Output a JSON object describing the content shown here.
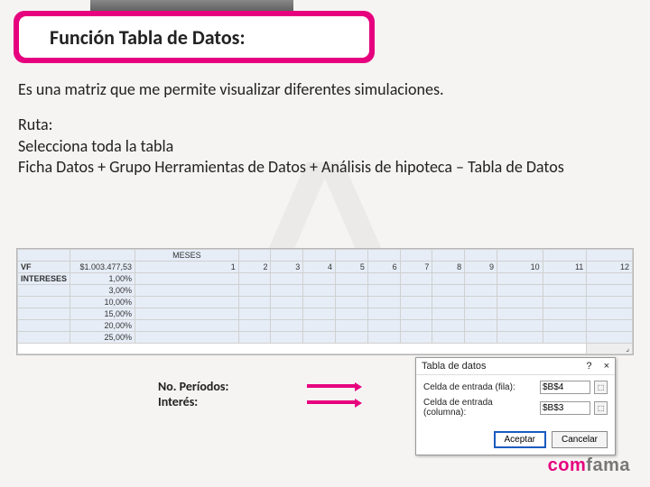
{
  "banner": {
    "title": "Función  Tabla de Datos:"
  },
  "content": {
    "intro": "Es una matriz que me permite visualizar diferentes simulaciones.",
    "ruta_label": "Ruta:",
    "ruta1": "Selecciona toda la tabla",
    "ruta2": "Ficha Datos + Grupo Herramientas de Datos + Análisis de hipoteca – Tabla de Datos"
  },
  "sheet": {
    "header_meses": "MESES",
    "row_vf_label": "VF",
    "row_vf_value": "$1.003.477,53",
    "row_int_label": "INTERESES",
    "months": [
      "1",
      "2",
      "3",
      "4",
      "5",
      "6",
      "7",
      "8",
      "9",
      "10",
      "11",
      "12"
    ],
    "rates": [
      "1,00%",
      "3,00%",
      "10,00%",
      "15,00%",
      "20,00%",
      "25,00%"
    ]
  },
  "labels": {
    "periodos": "No. Períodos:",
    "interes": "Interés:"
  },
  "dialog": {
    "title": "Tabla de datos",
    "help": "?",
    "close": "×",
    "row_label": "Celda de entrada (fila):",
    "row_value": "$B$4",
    "col_label": "Celda de entrada (columna):",
    "col_value": "$B$3",
    "accept": "Aceptar",
    "cancel": "Cancelar"
  },
  "brand": {
    "part1": "com",
    "part2": "fama"
  },
  "watermark": "^"
}
